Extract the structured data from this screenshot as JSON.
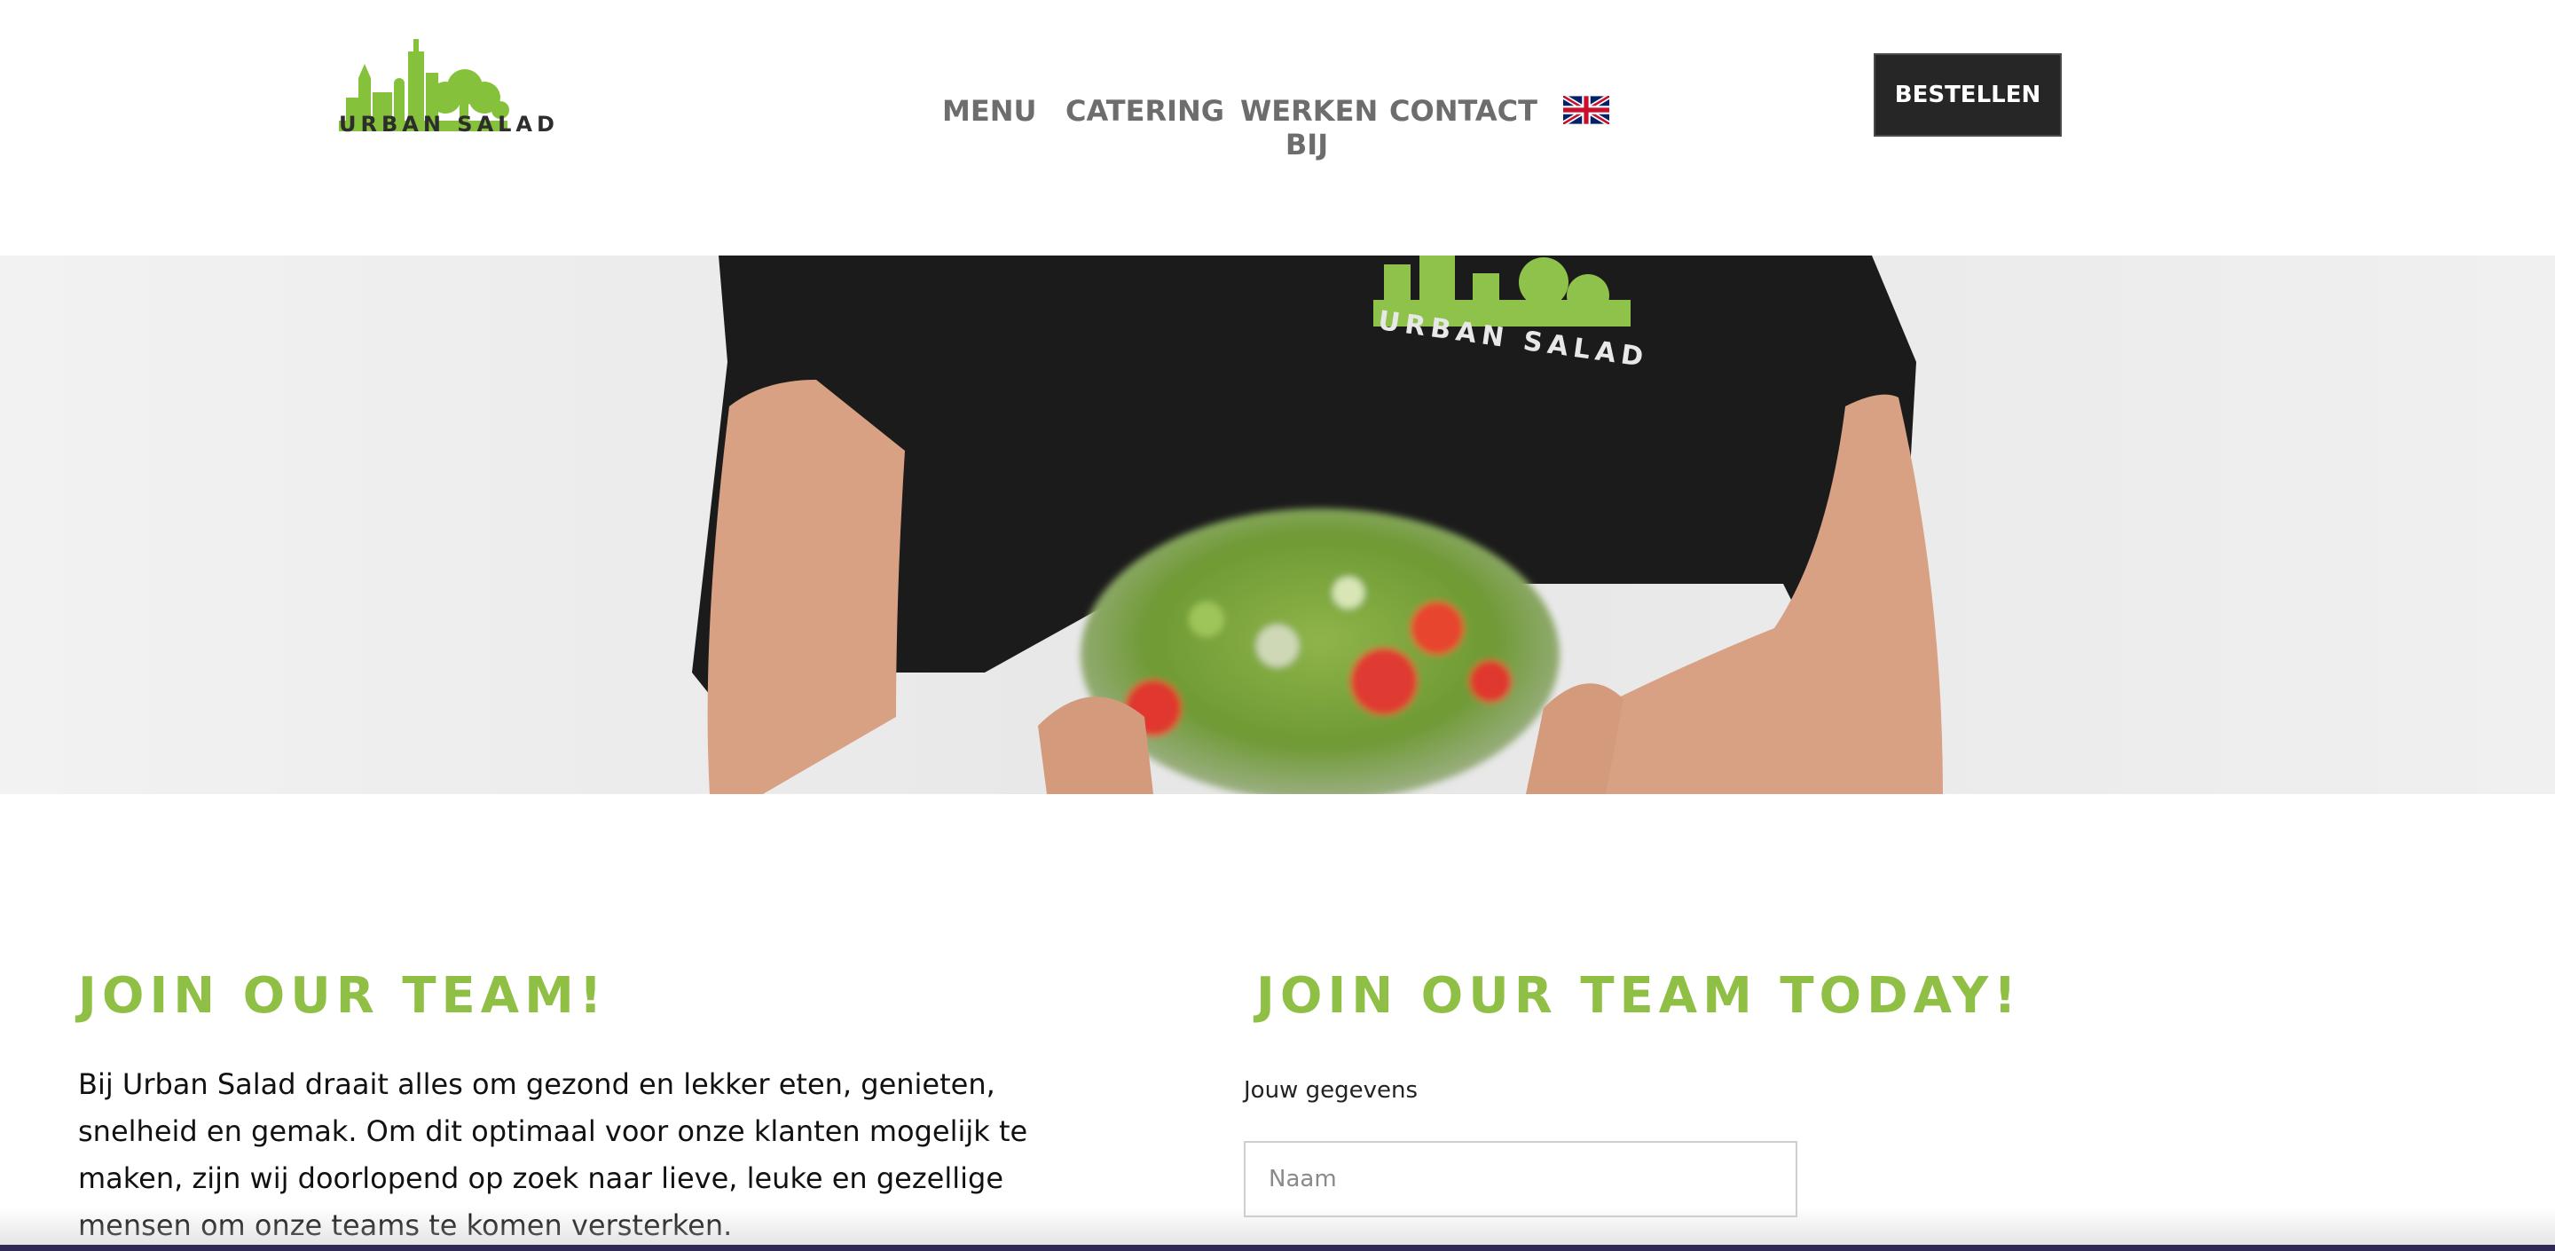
{
  "header": {
    "logo_text": "URBAN SALAD",
    "nav": [
      "MENU",
      "CATERING",
      "WERKEN BIJ",
      "CONTACT"
    ],
    "language_icon": "uk-flag-icon",
    "order_button": "BESTELLEN"
  },
  "main": {
    "left_heading": "JOIN OUR TEAM!",
    "intro_text": "Bij Urban Salad draait alles om gezond en lekker eten, genieten, snelheid en gemak. Om dit optimaal voor onze klanten mogelijk te maken, zijn wij doorlopend op zoek naar lieve, leuke en gezellige mensen om onze teams te komen versterken.",
    "right_heading": "JOIN OUR TEAM TODAY!",
    "form": {
      "section_label": "Jouw gegevens",
      "name_placeholder": "Naam",
      "name_value": ""
    }
  },
  "colors": {
    "accent_green": "#8fbf45",
    "nav_text": "#6d6d6d",
    "button_bg": "#262626",
    "shirt": "#1b1b1b"
  }
}
